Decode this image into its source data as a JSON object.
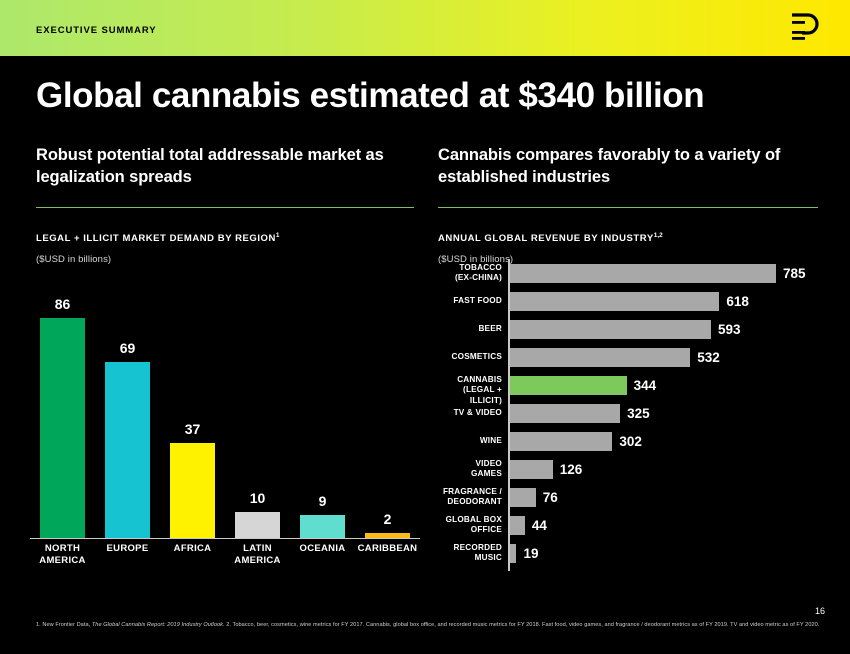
{
  "header": {
    "eyebrow": "EXECUTIVE SUMMARY",
    "logo_icon": "pitchbook-p-logo-icon",
    "gradient_from": "#ADE86B",
    "gradient_to": "#FFE800"
  },
  "title": "Global cannabis estimated at $340 billion",
  "left_panel": {
    "heading": "Robust potential total addressable market as legalization spreads",
    "subhead": "LEGAL + ILLICIT MARKET DEMAND BY REGION",
    "subhead_sup": "1",
    "units": "($USD in billions)",
    "rule_color": "#7FBF5F"
  },
  "right_panel": {
    "heading": "Cannabis compares favorably to a variety of established industries",
    "subhead": "ANNUAL GLOBAL REVENUE BY INDUSTRY",
    "subhead_sup": "1,2",
    "units": "($USD in billions)",
    "rule_color": "#7FBF5F"
  },
  "footer": {
    "page_number": "16",
    "footnote_part1": "1. New Frontier Data, ",
    "footnote_italic": "The Global Cannabis Report: 2019 Industry Outlook",
    "footnote_part2": ". 2. Tobacco, beer, cosmetics, wine metrics for FY 2017. Cannabis, global box office, and recorded music metrics for FY 2018. Fast food, video games, and fragrance / deodorant metrics as of FY 2019. TV and video metric as of FY 2020."
  },
  "chart_data": [
    {
      "type": "bar",
      "orientation": "vertical",
      "title": "LEGAL + ILLICIT MARKET DEMAND BY REGION",
      "xlabel": "",
      "ylabel": "($USD in billions)",
      "ylim": [
        0,
        86
      ],
      "grid": false,
      "legend": "none",
      "categories": [
        "NORTH AMERICA",
        "EUROPE",
        "AFRICA",
        "LATIN AMERICA",
        "OCEANIA",
        "CARIBBEAN"
      ],
      "values": [
        86,
        69,
        37,
        10,
        9,
        2
      ],
      "colors": [
        "#00A65A",
        "#16C3D1",
        "#FFF200",
        "#D6D6D6",
        "#5FDDCF",
        "#FBBA16"
      ]
    },
    {
      "type": "bar",
      "orientation": "horizontal",
      "title": "ANNUAL GLOBAL REVENUE BY INDUSTRY",
      "xlabel": "($USD in billions)",
      "ylabel": "",
      "xlim": [
        0,
        785
      ],
      "grid": false,
      "legend": "none",
      "highlight_category": "CANNABIS (LEGAL + ILLICIT)",
      "categories": [
        "TOBACCO (EX-CHINA)",
        "FAST FOOD",
        "BEER",
        "COSMETICS",
        "CANNABIS (LEGAL + ILLICIT)",
        "TV & VIDEO",
        "WINE",
        "VIDEO GAMES",
        "FRAGRANCE / DEODORANT",
        "GLOBAL BOX OFFICE",
        "RECORDED MUSIC"
      ],
      "category_lines": [
        [
          "TOBACCO",
          "(EX-CHINA)"
        ],
        [
          "FAST FOOD"
        ],
        [
          "BEER"
        ],
        [
          "COSMETICS"
        ],
        [
          "CANNABIS",
          "(LEGAL + ILLICIT)"
        ],
        [
          "TV & VIDEO"
        ],
        [
          "WINE"
        ],
        [
          "VIDEO",
          "GAMES"
        ],
        [
          "FRAGRANCE /",
          "DEODORANT"
        ],
        [
          "GLOBAL BOX",
          "OFFICE"
        ],
        [
          "RECORDED",
          "MUSIC"
        ]
      ],
      "values": [
        785,
        618,
        593,
        532,
        344,
        325,
        302,
        126,
        76,
        44,
        19
      ],
      "colors": [
        "#A8A8A8",
        "#A8A8A8",
        "#A8A8A8",
        "#A8A8A8",
        "#7DC95B",
        "#A8A8A8",
        "#A8A8A8",
        "#A8A8A8",
        "#A8A8A8",
        "#A8A8A8",
        "#A8A8A8"
      ]
    }
  ]
}
